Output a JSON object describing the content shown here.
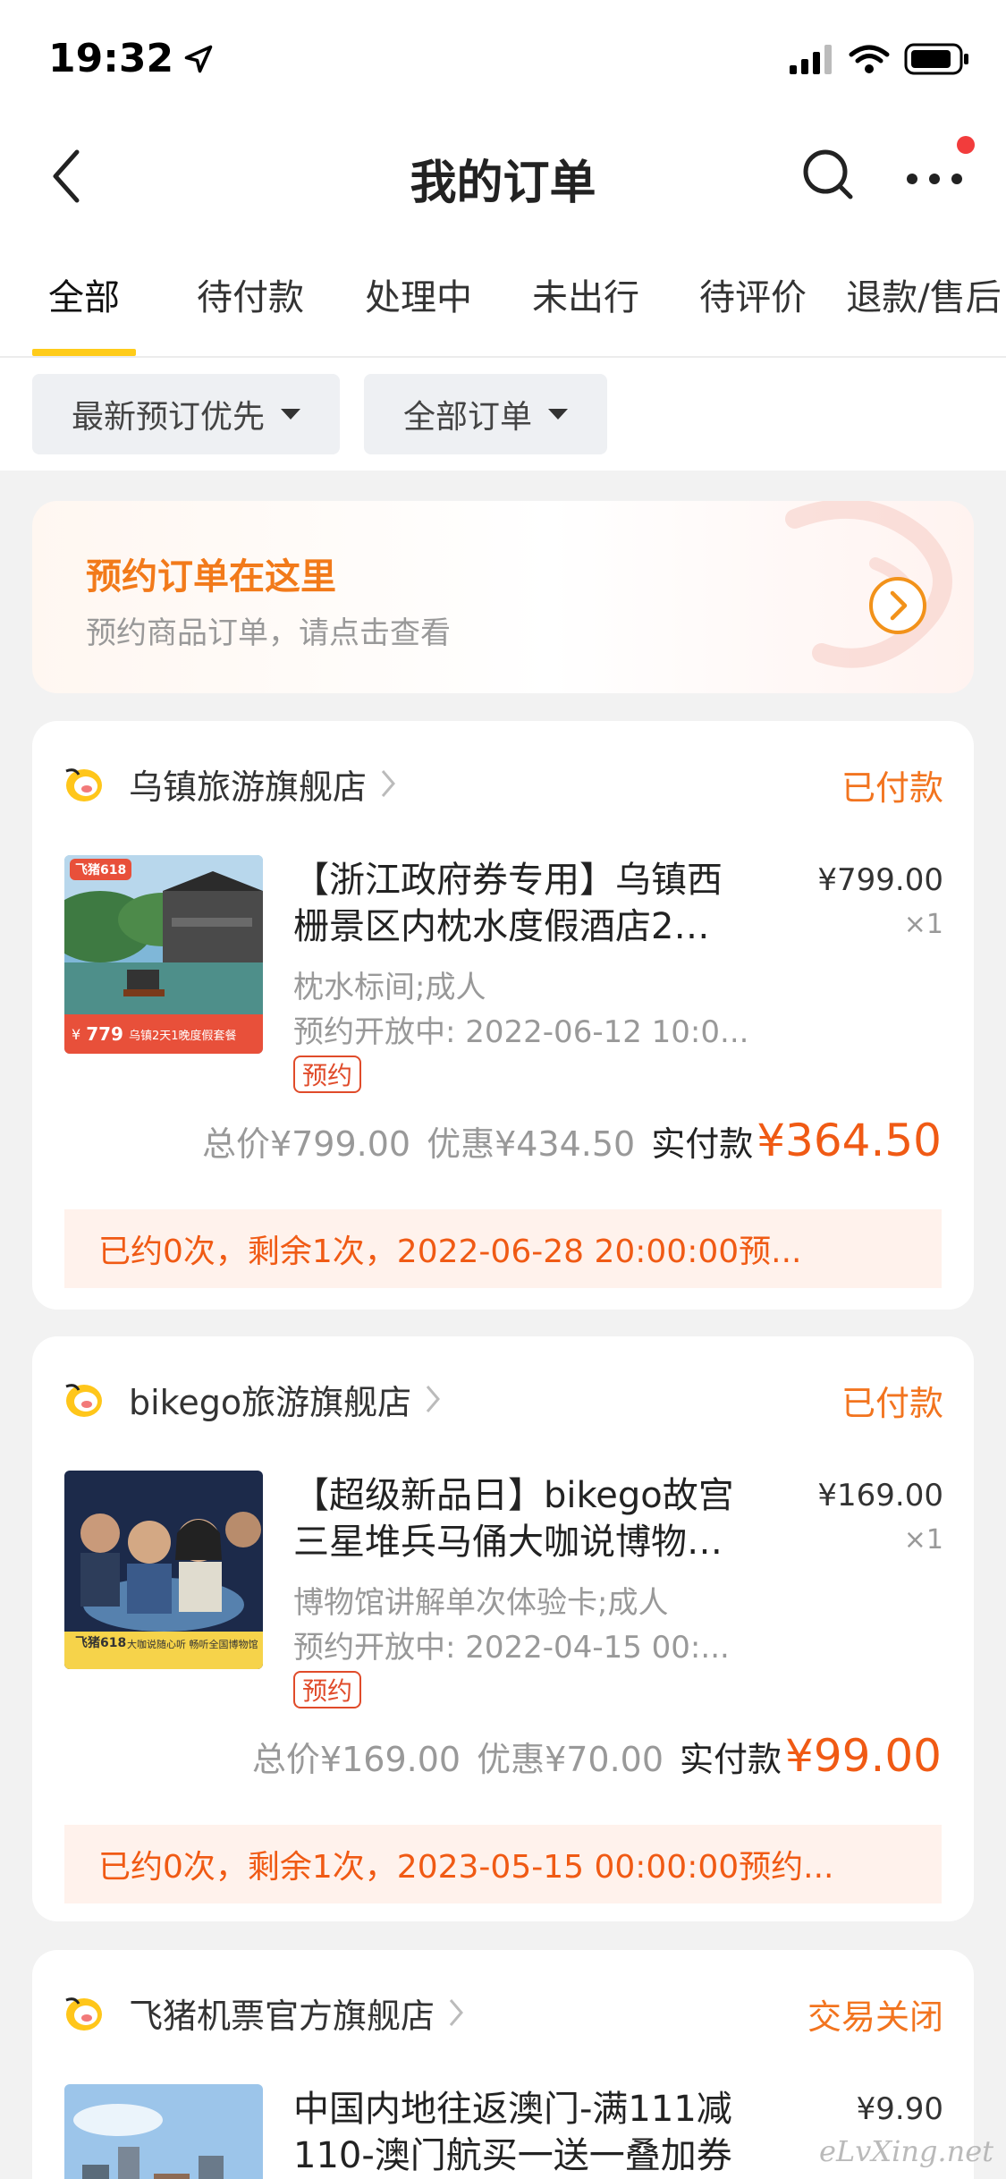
{
  "status_bar": {
    "time": "19:32"
  },
  "nav": {
    "title": "我的订单"
  },
  "tabs": [
    {
      "label": "全部"
    },
    {
      "label": "待付款"
    },
    {
      "label": "处理中"
    },
    {
      "label": "未出行"
    },
    {
      "label": "待评价"
    },
    {
      "label": "退款/售后"
    }
  ],
  "filters": [
    {
      "label": "最新预订优先"
    },
    {
      "label": "全部订单"
    }
  ],
  "promo": {
    "title": "预约订单在这里",
    "subtitle": "预约商品订单，请点击查看"
  },
  "orders": [
    {
      "store": "乌镇旅游旗舰店",
      "status": "已付款",
      "thumb_tag": "飞猪618",
      "thumb_caption": "乌镇2天1晚度假套餐",
      "thumb_price": "779",
      "title_line1": "【浙江政府券专用】乌镇西",
      "title_line2": "栅景区内枕水度假酒店2…",
      "price": "¥799.00",
      "qty": "×1",
      "spec": "枕水标间;成人",
      "open": "预约开放中: 2022-06-12 10:0...",
      "badge": "预约",
      "total": "总价¥799.00",
      "discount": "优惠¥434.50",
      "paid_label": "实付款",
      "paid_value": "¥364.50",
      "notice": "已约0次，剩余1次，2022-06-28 20:00:00预..."
    },
    {
      "store": "bikego旅游旗舰店",
      "status": "已付款",
      "thumb_tag": "飞猪618",
      "thumb_caption": "大咖说随心听 畅听全国博物馆",
      "thumb_price": "",
      "title_line1": "【超级新品日】bikego故宫",
      "title_line2": "三星堆兵马俑大咖说博物…",
      "price": "¥169.00",
      "qty": "×1",
      "spec": "博物馆讲解单次体验卡;成人",
      "open": "预约开放中: 2022-04-15 00:...",
      "badge": "预约",
      "total": "总价¥169.00",
      "discount": "优惠¥70.00",
      "paid_label": "实付款",
      "paid_value": "¥99.00",
      "notice": "已约0次，剩余1次，2023-05-15 00:00:00预约..."
    },
    {
      "store": "飞猪机票官方旗舰店",
      "status": "交易关闭",
      "title_line1": "中国内地往返澳门-满111减",
      "title_line2": "110-澳门航买一送一叠加券",
      "price": "¥9.90"
    }
  ],
  "watermark": "eLvXing.net",
  "colors": {
    "accent_orange": "#f05a14",
    "tab_underline": "#ffcc1a",
    "status_orange": "#f2741f"
  }
}
